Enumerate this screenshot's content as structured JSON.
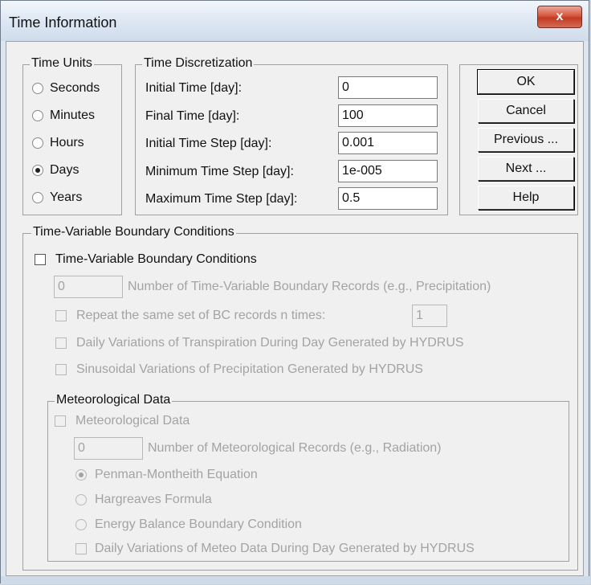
{
  "window": {
    "title": "Time Information",
    "close_label": "x"
  },
  "time_units": {
    "legend": "Time Units",
    "options": [
      {
        "label": "Seconds",
        "checked": false
      },
      {
        "label": "Minutes",
        "checked": false
      },
      {
        "label": "Hours",
        "checked": false
      },
      {
        "label": "Days",
        "checked": true
      },
      {
        "label": "Years",
        "checked": false
      }
    ]
  },
  "time_discretization": {
    "legend": "Time Discretization",
    "fields": [
      {
        "label": "Initial Time [day]:",
        "value": "0"
      },
      {
        "label": "Final Time [day]:",
        "value": "100"
      },
      {
        "label": "Initial Time Step [day]:",
        "value": "0.001"
      },
      {
        "label": "Minimum Time Step [day]:",
        "value": "1e-005"
      },
      {
        "label": "Maximum Time Step [day]:",
        "value": "0.5"
      }
    ]
  },
  "buttons": {
    "ok": "OK",
    "cancel": "Cancel",
    "previous": "Previous ...",
    "next": "Next ...",
    "help": "Help"
  },
  "tvbc": {
    "legend": "Time-Variable Boundary Conditions",
    "checkbox_label": "Time-Variable Boundary Conditions",
    "records_value": "0",
    "records_label": "Number of Time-Variable Boundary Records (e.g., Precipitation)",
    "repeat_label": "Repeat the same set of BC records n times:",
    "repeat_value": "1",
    "daily_transpiration_label": "Daily Variations of Transpiration During Day Generated by HYDRUS",
    "sinusoidal_label": "Sinusoidal Variations of Precipitation Generated by HYDRUS"
  },
  "meteo": {
    "legend": "Meteorological Data",
    "checkbox_label": "Meteorological Data",
    "records_value": "0",
    "records_label": "Number of Meteorological Records (e.g., Radiation)",
    "options": [
      {
        "label": "Penman-Montheith Equation",
        "checked": true
      },
      {
        "label": "Hargreaves Formula",
        "checked": false
      },
      {
        "label": "Energy Balance Boundary Condition",
        "checked": false
      }
    ],
    "daily_meteo_label": "Daily Variations of Meteo Data During Day Generated by HYDRUS"
  }
}
